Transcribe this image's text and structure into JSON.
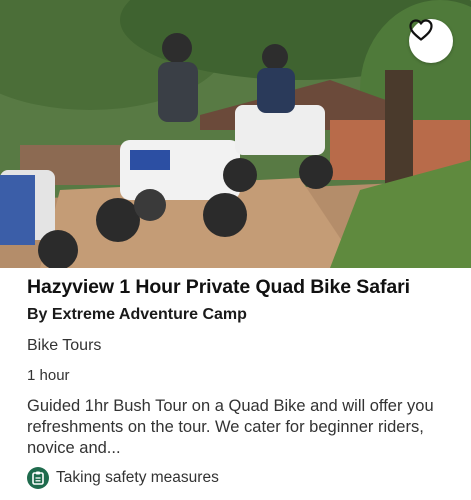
{
  "listing": {
    "title": "Hazyview 1 Hour Private Quad Bike Safari",
    "operator": "By Extreme Adventure Camp",
    "category": "Bike Tours",
    "duration": "1 hour",
    "description": "Guided 1hr Bush Tour on a Quad Bike and will offer you refreshments on the tour. We cater for beginner riders, novice and...",
    "safety_label": "Taking safety measures",
    "photo_icon": "quad-bike-photo",
    "favorite_icon": "heart-outline-icon",
    "safety_icon": "safety-clipboard-icon"
  },
  "colors": {
    "safety_green": "#1f6b4d",
    "text_dark": "#111111",
    "text_body": "#333333"
  }
}
